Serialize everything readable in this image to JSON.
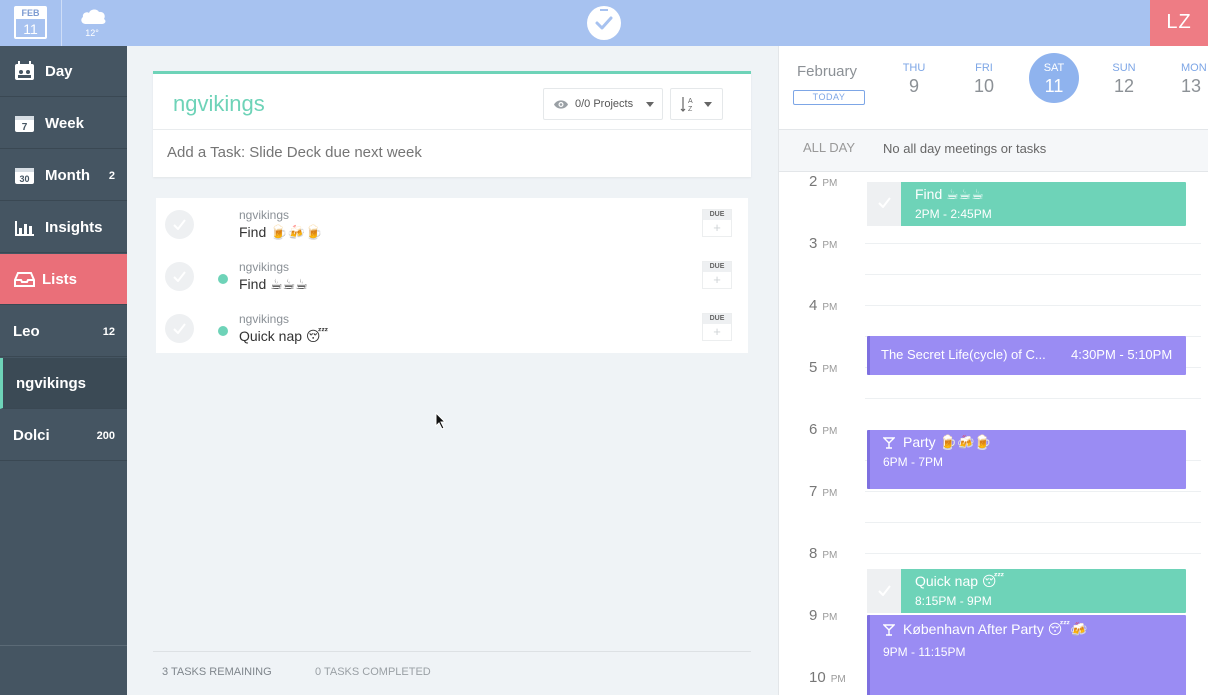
{
  "topbar": {
    "date_month": "FEB",
    "date_day": "11",
    "weather_temp": "12°",
    "user_initials": "LZ"
  },
  "sidebar": {
    "nav": [
      {
        "label": "Day",
        "count": ""
      },
      {
        "label": "Week",
        "count": ""
      },
      {
        "label": "Month",
        "count": "2"
      },
      {
        "label": "Insights",
        "count": ""
      },
      {
        "label": "Lists",
        "count": ""
      }
    ],
    "lists": [
      {
        "label": "Leo",
        "count": "12"
      },
      {
        "label": "ngvikings",
        "count": ""
      },
      {
        "label": "Dolci",
        "count": "200"
      }
    ]
  },
  "main": {
    "list_title": "ngvikings",
    "projects_filter": "0/0 Projects",
    "add_task_placeholder": "Add a Task: Slide Deck due next week",
    "due_label": "DUE",
    "tasks": [
      {
        "project": "ngvikings",
        "name": "Find 🍺🍻🍺"
      },
      {
        "project": "ngvikings",
        "name": "Find ☕☕☕"
      },
      {
        "project": "ngvikings",
        "name": "Quick nap 😴"
      }
    ],
    "footer": {
      "remaining": "3 TASKS REMAINING",
      "completed": "0 TASKS COMPLETED"
    }
  },
  "calendar": {
    "month": "February",
    "today_label": "TODAY",
    "days": [
      {
        "name": "THU",
        "num": "9"
      },
      {
        "name": "FRI",
        "num": "10"
      },
      {
        "name": "SAT",
        "num": "11"
      },
      {
        "name": "SUN",
        "num": "12"
      },
      {
        "name": "MON",
        "num": "13"
      }
    ],
    "all_day_label": "ALL DAY",
    "all_day_text": "No all day meetings or tasks",
    "hours": [
      "2",
      "3",
      "4",
      "5",
      "6",
      "7",
      "8",
      "9",
      "10"
    ],
    "pm_label": "PM",
    "events": [
      {
        "title": "Find ☕☕☕",
        "time": "2PM - 2:45PM"
      },
      {
        "title": "The Secret Life(cycle) of C...",
        "time": "4:30PM - 5:10PM"
      },
      {
        "title": "Party 🍺🍻🍺",
        "time": "6PM - 7PM"
      },
      {
        "title": "Quick nap 😴",
        "time": "8:15PM - 9PM"
      },
      {
        "title": "København After Party 😴🍻",
        "time": "9PM - 11:15PM"
      }
    ]
  },
  "colors": {
    "accent_green": "#6ed3b8",
    "accent_purple": "#9a8cf3",
    "topbar_blue": "#a7c2f0",
    "active_red": "#ea6f79"
  }
}
